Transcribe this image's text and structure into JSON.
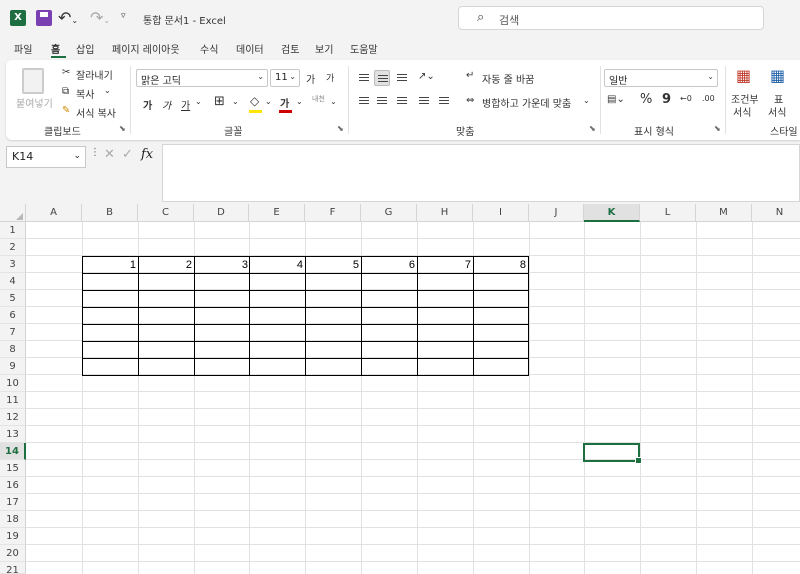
{
  "titlebar": {
    "app_logo": "X",
    "title": "통합 문서1  -  Excel",
    "search_placeholder": "검색"
  },
  "tabs": [
    "파일",
    "홈",
    "삽입",
    "페이지 레이아웃",
    "수식",
    "데이터",
    "검토",
    "보기",
    "도움말"
  ],
  "ribbon": {
    "clipboard": {
      "paste": "붙여넣기",
      "cut": "잘라내기",
      "copy": "복사",
      "format_painter": "서식 복사",
      "label": "클립보드"
    },
    "font": {
      "name": "맑은 고딕",
      "size": "11",
      "grow": "가",
      "shrink": "가",
      "bold": "가",
      "italic": "가",
      "underline": "가",
      "font_color": "가",
      "phonetic": "내천",
      "label": "글꼴"
    },
    "alignment": {
      "wrap": "자동 줄 바꿈",
      "merge": "병합하고 가운데 맞춤",
      "label": "맞춤"
    },
    "number": {
      "format": "일반",
      "percent": "%",
      "comma": "9",
      "label": "표시 형식"
    },
    "styles": {
      "conditional": "조건부",
      "conditional2": "서식",
      "table": "표",
      "table2": "서식",
      "label": "스타일"
    }
  },
  "formula_bar": {
    "name_box": "K14",
    "fx": "fx",
    "cancel": "✕",
    "enter": "✓",
    "value": ""
  },
  "sheet": {
    "columns": [
      "A",
      "B",
      "C",
      "D",
      "E",
      "F",
      "G",
      "H",
      "I",
      "J",
      "K",
      "L",
      "M",
      "N"
    ],
    "rows": [
      "1",
      "2",
      "3",
      "4",
      "5",
      "6",
      "7",
      "8",
      "9",
      "10",
      "11",
      "12",
      "13",
      "14",
      "15",
      "16",
      "17",
      "18",
      "19",
      "20",
      "21"
    ],
    "selected_column": "K",
    "selected_row": "14",
    "row3_values": [
      "1",
      "2",
      "3",
      "4",
      "5",
      "6",
      "7",
      "8"
    ]
  },
  "colors": {
    "accent": "#1d6f42",
    "save_icon": "#7a3fb0",
    "font_color_bar": "#d00000",
    "fill_color_bar": "#ffe600"
  }
}
